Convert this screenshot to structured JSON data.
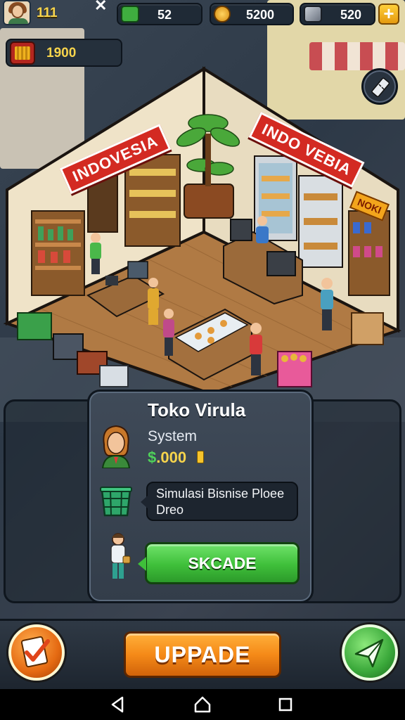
{
  "hud": {
    "level": "111",
    "close_symbol": "✕",
    "cash": "52",
    "coins": "5200",
    "materials": "520",
    "add_symbol": "+",
    "crate_count": "1900"
  },
  "shop": {
    "sign_left": "INDOVESIA",
    "sign_right": "INDO VEBIA",
    "sign_small": "NOKI"
  },
  "card": {
    "title": "Toko Virula",
    "subtitle": "System",
    "money_symbol": "$",
    "money_value": ".000",
    "description": "Simulasi Bisnise Ploee Dreo",
    "action_label": "SKCADE"
  },
  "bottom": {
    "upgrade_label": "UPPADE"
  },
  "icons": {
    "cash": "cash-stack-icon",
    "coins": "gold-coin-icon",
    "materials": "metal-block-icon",
    "crate": "crate-icon",
    "tool": "ruler-icon",
    "left_round": "checklist-icon",
    "right_round": "send-arrow-icon"
  },
  "colors": {
    "accent_gold": "#f7d44c",
    "sign_red": "#d32a22",
    "button_orange": "#f58a18",
    "button_green": "#3fbf3a"
  }
}
